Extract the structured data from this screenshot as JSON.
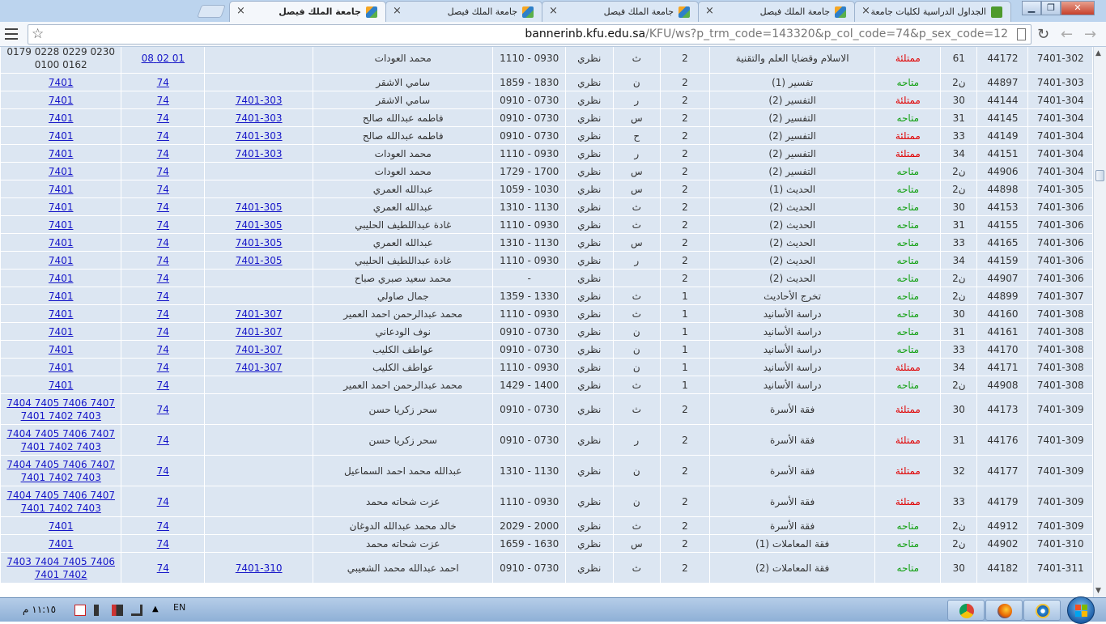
{
  "browser": {
    "tabs": [
      {
        "title": "جامعة الملك فيصل",
        "active": true
      },
      {
        "title": "جامعة الملك فيصل",
        "active": false
      },
      {
        "title": "جامعة الملك فيصل",
        "active": false
      },
      {
        "title": "جامعة الملك فيصل",
        "active": false
      },
      {
        "title": "الجداول الدراسية لكليات جامعة",
        "active": false
      }
    ],
    "close_glyph": "×",
    "url_host": "bannerinb.kfu.edu.sa",
    "url_path": "/KFU/ws?p_trm_code=143320&p_col_code=74&p_sex_code=12",
    "window_buttons": {
      "minimize": "▁",
      "maximize": "❐",
      "close": "✕"
    }
  },
  "status_colors": {
    "full": "#e00000",
    "open": "#12a012"
  },
  "rows": [
    {
      "course": "7401-302",
      "crn": "44172",
      "seats": "61",
      "status": "ممتلئة",
      "state": "full",
      "title": "الاسلام وقضايا العلم والتقنية",
      "hours": "2",
      "day": "ث",
      "type": "نظري",
      "time": "0930 - 1110",
      "instructor": "محمد العودات",
      "pre": "",
      "col": "",
      "sections": "0179 0228 0229 0230 0100 0162",
      "sec_link": false,
      "extra": "01 02 08",
      "tall": true
    },
    {
      "course": "7401-303",
      "crn": "44897",
      "seats": "ن2",
      "status": "متاحه",
      "state": "open",
      "title": "تفسير (1)",
      "hours": "2",
      "day": "ن",
      "type": "نظري",
      "time": "1830 - 1859",
      "instructor": "سامي الاشقر",
      "pre": "",
      "col": "74",
      "sections": "7401",
      "sec_link": true
    },
    {
      "course": "7401-304",
      "crn": "44144",
      "seats": "30",
      "status": "ممتلئة",
      "state": "full",
      "title": "التفسير (2)",
      "hours": "2",
      "day": "ر",
      "type": "نظري",
      "time": "0730 - 0910",
      "instructor": "سامي الاشقر",
      "pre": "7401-303",
      "col": "74",
      "sections": "7401",
      "sec_link": true
    },
    {
      "course": "7401-304",
      "crn": "44145",
      "seats": "31",
      "status": "متاحه",
      "state": "open",
      "title": "التفسير (2)",
      "hours": "2",
      "day": "س",
      "type": "نظري",
      "time": "0730 - 0910",
      "instructor": "فاطمه عبدالله صالح",
      "pre": "7401-303",
      "col": "74",
      "sections": "7401",
      "sec_link": true
    },
    {
      "course": "7401-304",
      "crn": "44149",
      "seats": "33",
      "status": "ممتلئة",
      "state": "full",
      "title": "التفسير (2)",
      "hours": "2",
      "day": "ح",
      "type": "نظري",
      "time": "0730 - 0910",
      "instructor": "فاطمه عبدالله صالح",
      "pre": "7401-303",
      "col": "74",
      "sections": "7401",
      "sec_link": true
    },
    {
      "course": "7401-304",
      "crn": "44151",
      "seats": "34",
      "status": "ممتلئة",
      "state": "full",
      "title": "التفسير (2)",
      "hours": "2",
      "day": "ر",
      "type": "نظري",
      "time": "0930 - 1110",
      "instructor": "محمد العودات",
      "pre": "7401-303",
      "col": "74",
      "sections": "7401",
      "sec_link": true
    },
    {
      "course": "7401-304",
      "crn": "44906",
      "seats": "ن2",
      "status": "متاحه",
      "state": "open",
      "title": "التفسير (2)",
      "hours": "2",
      "day": "س",
      "type": "نظري",
      "time": "1700 - 1729",
      "instructor": "محمد العودات",
      "pre": "",
      "col": "74",
      "sections": "7401",
      "sec_link": true
    },
    {
      "course": "7401-305",
      "crn": "44898",
      "seats": "ن2",
      "status": "متاحه",
      "state": "open",
      "title": "الحديث (1)",
      "hours": "2",
      "day": "س",
      "type": "نظري",
      "time": "1030 - 1059",
      "instructor": "عبدالله العمري",
      "pre": "",
      "col": "74",
      "sections": "7401",
      "sec_link": true
    },
    {
      "course": "7401-306",
      "crn": "44153",
      "seats": "30",
      "status": "متاحه",
      "state": "open",
      "title": "الحديث (2)",
      "hours": "2",
      "day": "ث",
      "type": "نظري",
      "time": "1130 - 1310",
      "instructor": "عبدالله العمري",
      "pre": "7401-305",
      "col": "74",
      "sections": "7401",
      "sec_link": true
    },
    {
      "course": "7401-306",
      "crn": "44155",
      "seats": "31",
      "status": "متاحه",
      "state": "open",
      "title": "الحديث (2)",
      "hours": "2",
      "day": "ث",
      "type": "نظري",
      "time": "0930 - 1110",
      "instructor": "غادة عبداللطيف الحليبي",
      "pre": "7401-305",
      "col": "74",
      "sections": "7401",
      "sec_link": true
    },
    {
      "course": "7401-306",
      "crn": "44165",
      "seats": "33",
      "status": "متاحه",
      "state": "open",
      "title": "الحديث (2)",
      "hours": "2",
      "day": "س",
      "type": "نظري",
      "time": "1130 - 1310",
      "instructor": "عبدالله العمري",
      "pre": "7401-305",
      "col": "74",
      "sections": "7401",
      "sec_link": true
    },
    {
      "course": "7401-306",
      "crn": "44159",
      "seats": "34",
      "status": "متاحه",
      "state": "open",
      "title": "الحديث (2)",
      "hours": "2",
      "day": "ر",
      "type": "نظري",
      "time": "0930 - 1110",
      "instructor": "غادة عبداللطيف الحليبي",
      "pre": "7401-305",
      "col": "74",
      "sections": "7401",
      "sec_link": true
    },
    {
      "course": "7401-306",
      "crn": "44907",
      "seats": "ن2",
      "status": "متاحه",
      "state": "open",
      "title": "الحديث (2)",
      "hours": "2",
      "day": "",
      "type": "نظري",
      "time": "-",
      "instructor": "محمد سعيد صبري صباح",
      "pre": "",
      "col": "74",
      "sections": "7401",
      "sec_link": true
    },
    {
      "course": "7401-307",
      "crn": "44899",
      "seats": "ن2",
      "status": "متاحه",
      "state": "open",
      "title": "تخرج الأحاديث",
      "hours": "1",
      "day": "ث",
      "type": "نظري",
      "time": "1330 - 1359",
      "instructor": "جمال صاولي",
      "pre": "",
      "col": "74",
      "sections": "7401",
      "sec_link": true
    },
    {
      "course": "7401-308",
      "crn": "44160",
      "seats": "30",
      "status": "متاحه",
      "state": "open",
      "title": "دراسة الأسانيد",
      "hours": "1",
      "day": "ث",
      "type": "نظري",
      "time": "0930 - 1110",
      "instructor": "محمد عبدالرحمن احمد العمير",
      "pre": "7401-307",
      "col": "74",
      "sections": "7401",
      "sec_link": true
    },
    {
      "course": "7401-308",
      "crn": "44161",
      "seats": "31",
      "status": "متاحه",
      "state": "open",
      "title": "دراسة الأسانيد",
      "hours": "1",
      "day": "ن",
      "type": "نظري",
      "time": "0730 - 0910",
      "instructor": "نوف الودعاني",
      "pre": "7401-307",
      "col": "74",
      "sections": "7401",
      "sec_link": true
    },
    {
      "course": "7401-308",
      "crn": "44170",
      "seats": "33",
      "status": "متاحه",
      "state": "open",
      "title": "دراسة الأسانيد",
      "hours": "1",
      "day": "ن",
      "type": "نظري",
      "time": "0730 - 0910",
      "instructor": "عواطف الكليب",
      "pre": "7401-307",
      "col": "74",
      "sections": "7401",
      "sec_link": true
    },
    {
      "course": "7401-308",
      "crn": "44171",
      "seats": "34",
      "status": "ممتلئة",
      "state": "full",
      "title": "دراسة الأسانيد",
      "hours": "1",
      "day": "ن",
      "type": "نظري",
      "time": "0930 - 1110",
      "instructor": "عواطف الكليب",
      "pre": "7401-307",
      "col": "74",
      "sections": "7401",
      "sec_link": true
    },
    {
      "course": "7401-308",
      "crn": "44908",
      "seats": "ن2",
      "status": "متاحه",
      "state": "open",
      "title": "دراسة الأسانيد",
      "hours": "1",
      "day": "ث",
      "type": "نظري",
      "time": "1400 - 1429",
      "instructor": "محمد عبدالرحمن احمد العمير",
      "pre": "",
      "col": "74",
      "sections": "7401",
      "sec_link": true
    },
    {
      "course": "7401-309",
      "crn": "44173",
      "seats": "30",
      "status": "ممتلئة",
      "state": "full",
      "title": "فقة الأسرة",
      "hours": "2",
      "day": "ث",
      "type": "نظري",
      "time": "0730 - 0910",
      "instructor": "سحر زكريا حسن",
      "pre": "",
      "col": "74",
      "sections": "7404 7405 7406 7407 7401 7402 7403",
      "sec_link": true,
      "tall": true
    },
    {
      "course": "7401-309",
      "crn": "44176",
      "seats": "31",
      "status": "ممتلئة",
      "state": "full",
      "title": "فقة الأسرة",
      "hours": "2",
      "day": "ر",
      "type": "نظري",
      "time": "0730 - 0910",
      "instructor": "سحر زكريا حسن",
      "pre": "",
      "col": "74",
      "sections": "7404 7405 7406 7407 7401 7402 7403",
      "sec_link": true,
      "tall": true
    },
    {
      "course": "7401-309",
      "crn": "44177",
      "seats": "32",
      "status": "ممتلئة",
      "state": "full",
      "title": "فقة الأسرة",
      "hours": "2",
      "day": "ن",
      "type": "نظري",
      "time": "1130 - 1310",
      "instructor": "عبدالله محمد احمد السماعيل",
      "pre": "",
      "col": "74",
      "sections": "7404 7405 7406 7407 7401 7402 7403",
      "sec_link": true,
      "tall": true
    },
    {
      "course": "7401-309",
      "crn": "44179",
      "seats": "33",
      "status": "ممتلئة",
      "state": "full",
      "title": "فقة الأسرة",
      "hours": "2",
      "day": "ن",
      "type": "نظري",
      "time": "0930 - 1110",
      "instructor": "عزت شحاته محمد",
      "pre": "",
      "col": "74",
      "sections": "7404 7405 7406 7407 7401 7402 7403",
      "sec_link": true,
      "tall": true
    },
    {
      "course": "7401-309",
      "crn": "44912",
      "seats": "ن2",
      "status": "متاحه",
      "state": "open",
      "title": "فقة الأسرة",
      "hours": "2",
      "day": "ث",
      "type": "نظري",
      "time": "2000 - 2029",
      "instructor": "خالد محمد عبدالله الدوغان",
      "pre": "",
      "col": "74",
      "sections": "7401",
      "sec_link": true
    },
    {
      "course": "7401-310",
      "crn": "44902",
      "seats": "ن2",
      "status": "متاحه",
      "state": "open",
      "title": "فقة المعاملات (1)",
      "hours": "2",
      "day": "س",
      "type": "نظري",
      "time": "1630 - 1659",
      "instructor": "عزت شحاته محمد",
      "pre": "",
      "col": "74",
      "sections": "7401",
      "sec_link": true
    },
    {
      "course": "7401-311",
      "crn": "44182",
      "seats": "30",
      "status": "متاحه",
      "state": "open",
      "title": "فقة المعاملات (2)",
      "hours": "2",
      "day": "ث",
      "type": "نظري",
      "time": "0730 - 0910",
      "instructor": "احمد عبدالله محمد الشعيبي",
      "pre": "7401-310",
      "col": "74",
      "sections": "7403 7404 7405 7406 7401 7402",
      "sec_link": true,
      "tall": true
    }
  ],
  "taskbar": {
    "clock": "١١:١٥ م",
    "language": "EN",
    "pinned": [
      "chrome-icon",
      "firefox-icon",
      "ie-icon"
    ]
  }
}
